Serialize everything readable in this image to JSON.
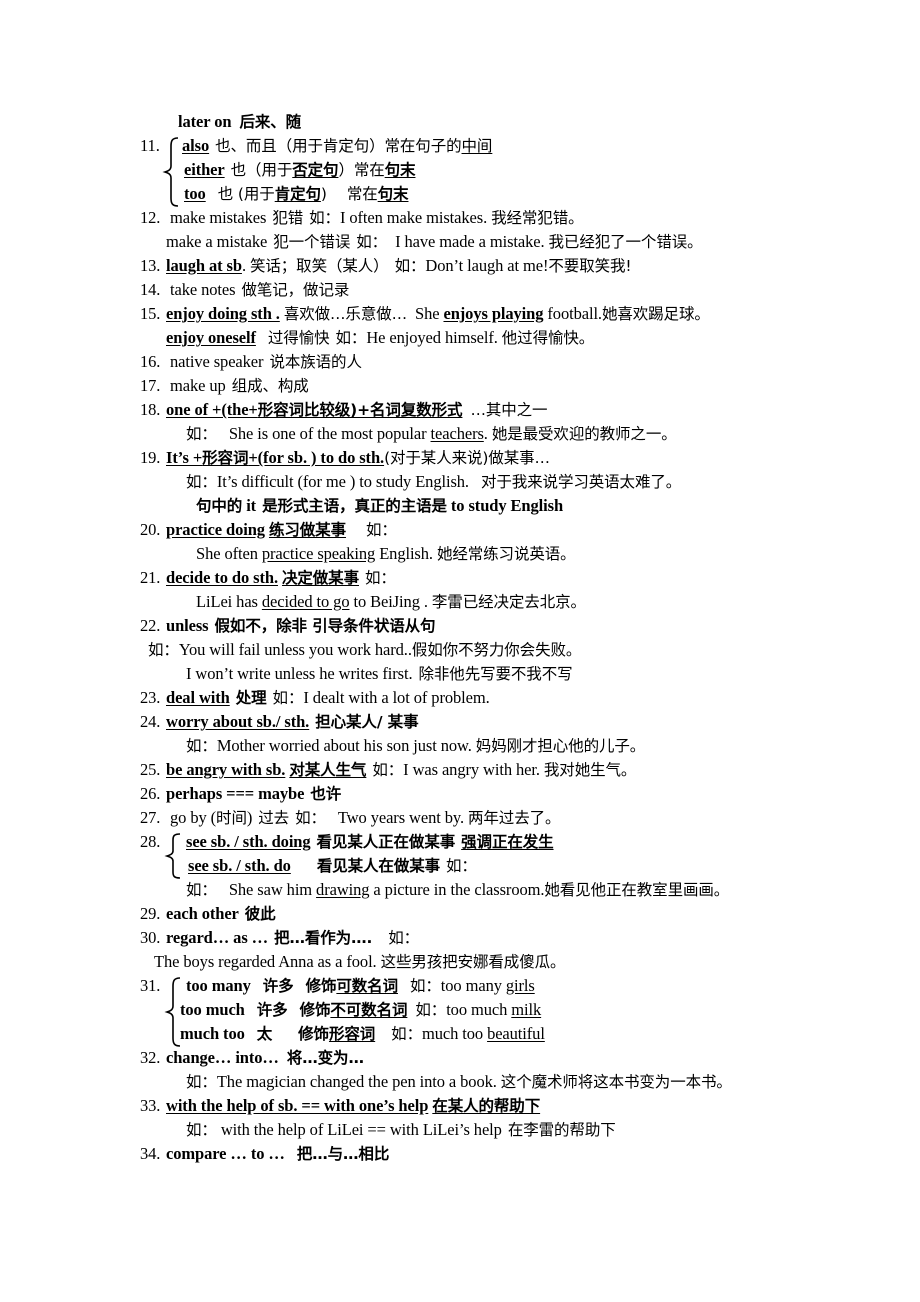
{
  "document": {
    "type": "english-grammar-phrase-notes",
    "lines": [
      {
        "id": "l0",
        "text": "later on  后来、随"
      },
      {
        "id": "l1a",
        "num": "11.",
        "text": "also  也、而且（用于肯定句）常在句子的中间"
      },
      {
        "id": "l1b",
        "text": "either  也（用于否定句）常在句末"
      },
      {
        "id": "l1c",
        "text": "too   也 (用于肯定句)    常在句末"
      },
      {
        "id": "l2",
        "num": "12.",
        "text": "make mistakes  犯错  如：I often make mistakes.  我经常犯错。"
      },
      {
        "id": "l3",
        "text": "make a mistake  犯一个错误  如：  I have made a mistake.  我已经犯了一个错误。"
      },
      {
        "id": "l4",
        "num": "13.",
        "text": "laugh at sb.  笑话；取笑（某人）  如：Don’t laugh at me!不要取笑我!"
      },
      {
        "id": "l5",
        "num": "14.",
        "text": "take notes  做笔记，做记录"
      },
      {
        "id": "l6",
        "num": "15.",
        "text": "enjoy doing sth .  喜欢做…乐意做…  She enjoys playing football.她喜欢踢足球。"
      },
      {
        "id": "l7",
        "text": "enjoy oneself   过得愉快  如：He enjoyed himself.  他过得愉快。"
      },
      {
        "id": "l8",
        "num": "16.",
        "text": "native speaker  说本族语的人"
      },
      {
        "id": "l9",
        "num": "17.",
        "text": "make up  组成、构成"
      },
      {
        "id": "l10",
        "num": "18.",
        "text": "one of +(the+  形容词比较级)+名词复数形式   …其中之一"
      },
      {
        "id": "l11",
        "text": "如：   She is one of the most popular teachers.  她是最受欢迎的教师之一。"
      },
      {
        "id": "l12",
        "num": "19.",
        "text": "It’s +形容词+(for sb. ) to do sth. (对于某人来说)做某事…"
      },
      {
        "id": "l13",
        "text": "如：It’s difficult (for me ) to study English.   对于我来说学习英语太难了。"
      },
      {
        "id": "l14",
        "text": "句中的 it  是形式主语，真正的主语是 to study English"
      },
      {
        "id": "l15",
        "num": "20.",
        "text": "practice doing  练习做某事    如："
      },
      {
        "id": "l16",
        "text": "She often practice speaking English.  她经常练习说英语。"
      },
      {
        "id": "l17",
        "num": "21.",
        "text": "decide to do sth.  决定做某事  如："
      },
      {
        "id": "l18",
        "text": "LiLei has decided to go to BeiJing .  李雷已经决定去北京。"
      },
      {
        "id": "l19",
        "num": "22.",
        "text": "unless  假如不，除非  引导条件状语从句"
      },
      {
        "id": "l20",
        "text": "如：You will fail unless you work hard..假如你不努力你会失败。"
      },
      {
        "id": "l21",
        "text": "I won’t write unless he writes first.  除非他先写要不我不写"
      },
      {
        "id": "l22",
        "num": "23.",
        "text": "deal with  处理  如：I dealt with a lot of problem."
      },
      {
        "id": "l23",
        "num": "24.",
        "text": "worry about sb./ sth.  担心某人/ 某事"
      },
      {
        "id": "l24",
        "text": "如：Mother worried about his son just now.  妈妈刚才担心他的儿子。"
      },
      {
        "id": "l25",
        "num": "25.",
        "text": "be angry with sb.  对某人生气  如：I was angry with her.  我对她生气。"
      },
      {
        "id": "l26",
        "num": "26.",
        "text": "perhaps === maybe  也许"
      },
      {
        "id": "l27",
        "num": "27.",
        "text": "go by (时间)  过去  如：   Two years went by.  两年过去了。"
      },
      {
        "id": "l28a",
        "num": "28.",
        "text": "see sb. / sth. doing  看见某人正在做某事  强调正在发生"
      },
      {
        "id": "l28b",
        "text": "see sb. / sth. do      看见某人在做某事  如："
      },
      {
        "id": "l29",
        "text": "如：   She saw him drawing a picture in the classroom.她看见他正在教室里画画。"
      },
      {
        "id": "l30",
        "num": "29.",
        "text": "each other  彼此"
      },
      {
        "id": "l31",
        "num": "30.",
        "text": "regard… as …  把…看作为….   如："
      },
      {
        "id": "l32",
        "text": "The boys regarded Anna as a fool.  这些男孩把安娜看成傻瓜。"
      },
      {
        "id": "l33a",
        "num": "31.",
        "text": "too many   许多   修饰可数名词   如：too many girls"
      },
      {
        "id": "l33b",
        "text": "too much   许多   修饰不可数名词  如：too much milk"
      },
      {
        "id": "l33c",
        "text": "much too   太    修饰形容词    如：much too beautiful"
      },
      {
        "id": "l34",
        "num": "32.",
        "text": "change…   into…   将…变为…"
      },
      {
        "id": "l35",
        "text": "如：The magician changed the pen into a book.  这个魔术师将这本书变为一本书。"
      },
      {
        "id": "l36",
        "num": "33.",
        "text": "with the help of sb. == with one’s help  在某人的帮助下"
      },
      {
        "id": "l37",
        "text": "如：with the help of LiLei == with LiLei’s help  在李雷的帮助下"
      },
      {
        "id": "l38",
        "num": "34.",
        "text": "compare … to …   把…与…相比"
      }
    ],
    "items": {
      "title_line": {
        "en": "later on",
        "cn": "后来、随"
      },
      "n11": {
        "num": "11.",
        "rows": [
          {
            "head": "also",
            "cn_a": "也、而且（用于肯定句）常在句子的",
            "cn_u": "中间"
          },
          {
            "head": "either",
            "cn_a": "也（用于",
            "cn_u1": "否定句",
            "cn_b": "）常在",
            "cn_u2": "句末"
          },
          {
            "head": "too",
            "cn_a": "也 (用于",
            "cn_u1": "肯定句",
            "cn_b": ")",
            "cn_c": "常在",
            "cn_u2": "句末"
          }
        ]
      },
      "n12": {
        "num": "12.",
        "phrase": "make mistakes",
        "cn": "犯错",
        "ru": "如：",
        "ex_en": "I often make mistakes.",
        "ex_cn": "我经常犯错。",
        "sub_phrase": "make a mistake",
        "sub_cn": "犯一个错误",
        "sub_ru": "如：",
        "sub_ex_en": "I have made a mistake.",
        "sub_ex_cn": "我已经犯了一个错误。"
      },
      "n13": {
        "num": "13.",
        "phrase": "laugh at sb",
        "tail": ".",
        "cn": "笑话；取笑（某人）",
        "ru": "如：",
        "ex_en": "Don’t laugh at me!",
        "ex_cn": "不要取笑我!"
      },
      "n14": {
        "num": "14.",
        "phrase": "take notes",
        "cn": "做笔记，做记录"
      },
      "n15": {
        "num": "15.",
        "phrase": "enjoy doing sth .",
        "cn": "喜欢做…乐意做…",
        "ex_lead": "She",
        "ex_bold": "enjoys playing",
        "ex_rest": "football.",
        "ex_cn": "她喜欢踢足球。",
        "sub_phrase": "enjoy oneself",
        "sub_cn": "过得愉快",
        "sub_ru": "如：",
        "sub_ex_en": "He enjoyed himself.",
        "sub_ex_cn": "他过得愉快。"
      },
      "n16": {
        "num": "16.",
        "phrase": "native speaker",
        "cn": "说本族语的人"
      },
      "n17": {
        "num": "17.",
        "phrase": "make up",
        "cn": "组成、构成"
      },
      "n18": {
        "num": "18.",
        "phrase_a": "one of +(the+",
        "phrase_cn": "形容词比较级)+名词复数形式",
        "cn": "…其中之一",
        "ru": "如：",
        "ex_a": "She is one of the most popular",
        "ex_u": "teachers",
        "ex_b": ".",
        "ex_cn": "她是最受欢迎的教师之一。"
      },
      "n19": {
        "num": "19.",
        "phrase_a": "It’s +",
        "phrase_cn": "形容词",
        "phrase_b": "+(for sb. ) to do sth.",
        "cn": "(对于某人来说)做某事…",
        "ru": "如：",
        "ex_en": "It’s difficult (for me ) to study English.",
        "ex_cn": "对于我来说学习英语太难了。",
        "note_cn_a": "句中的",
        "note_it": "it",
        "note_cn_b": "是形式主语，真正的主语是",
        "note_en": "to study English"
      },
      "n20": {
        "num": "20.",
        "phrase": "practice doing",
        "cn": "练习做某事",
        "ru": "如：",
        "ex_a": "She often",
        "ex_u": "practice speaking",
        "ex_b": "English.",
        "ex_cn": "她经常练习说英语。"
      },
      "n21": {
        "num": "21.",
        "phrase": "decide to do sth.",
        "cn": "决定做某事",
        "ru": "如：",
        "ex_a": "LiLei has",
        "ex_u": "decided to go",
        "ex_b": "to BeiJing .",
        "ex_cn": "李雷已经决定去北京。"
      },
      "n22": {
        "num": "22.",
        "phrase": "unless",
        "cn": "假如不，除非  引导条件状语从句",
        "ru": "如：",
        "ex1_en": "You will fail unless you work hard..",
        "ex1_cn": "假如你不努力你会失败。",
        "ex2_en": "I won’t write unless he writes first.",
        "ex2_cn": "除非他先写要不我不写"
      },
      "n23": {
        "num": "23.",
        "phrase": "deal with",
        "cn": "处理",
        "ru": "如：",
        "ex_en": "I dealt with a lot of problem."
      },
      "n24": {
        "num": "24.",
        "phrase": "worry about sb./ sth.",
        "cn": "担心某人/ 某事",
        "ru": "如：",
        "ex_en": "Mother worried about his son just now.",
        "ex_cn": "妈妈刚才担心他的儿子。"
      },
      "n25": {
        "num": "25.",
        "phrase": "be angry with sb.",
        "cn": "对某人生气",
        "ru": "如：",
        "ex_en": "I was angry with her.",
        "ex_cn": "我对她生气。"
      },
      "n26": {
        "num": "26.",
        "phrase": "perhaps === maybe",
        "cn": "也许"
      },
      "n27": {
        "num": "27.",
        "phrase_a": "go by (",
        "phrase_cn": "时间",
        "phrase_b": ")",
        "cn": "过去",
        "ru": "如：",
        "ex_en": "Two years went by.",
        "ex_cn": "两年过去了。"
      },
      "n28": {
        "num": "28.",
        "rows": [
          {
            "phrase": "see sb. / sth. doing",
            "cn": "看见某人正在做某事",
            "cn_u": "强调正在发生"
          },
          {
            "phrase": "see sb. / sth. do",
            "cn": "看见某人在做某事",
            "ru": "如："
          }
        ],
        "ru": "如：",
        "ex_a": "She saw him",
        "ex_u": "drawing",
        "ex_b": "a picture in the classroom.",
        "ex_cn": "她看见他正在教室里画画。"
      },
      "n29": {
        "num": "29.",
        "phrase": "each other",
        "cn": "彼此"
      },
      "n30": {
        "num": "30.",
        "phrase": "regard… as …",
        "cn": "把…看作为….",
        "ru": "如：",
        "ex_en": "The boys regarded Anna as a fool.",
        "ex_cn": "这些男孩把安娜看成傻瓜。"
      },
      "n31": {
        "num": "31.",
        "rows": [
          {
            "phrase": "too many",
            "cn1": "许多",
            "cn2a": "修饰",
            "cn2u": "可数名词",
            "ru": "如：",
            "ex_a": "too many",
            "ex_u": "girls"
          },
          {
            "phrase": "too much",
            "cn1": "许多",
            "cn2a": "修饰",
            "cn2u": "不可数名词",
            "ru": "如：",
            "ex_a": "too much",
            "ex_u": "milk"
          },
          {
            "phrase": "much too",
            "cn1": "太",
            "cn2a": "修饰",
            "cn2u": "形容词",
            "ru": "如：",
            "ex_a": "much too",
            "ex_u": "beautiful"
          }
        ]
      },
      "n32": {
        "num": "32.",
        "phrase": "change…   into…",
        "cn": "将…变为…",
        "ru": "如：",
        "ex_en": "The magician changed the pen into a book.",
        "ex_cn": "这个魔术师将这本书变为一本书。"
      },
      "n33": {
        "num": "33.",
        "phrase": "with the help of sb. == with one’s help",
        "cn": "在某人的帮助下",
        "ru": "如：",
        "ex_en": "with the help of LiLei == with LiLei’s help",
        "ex_cn": "在李雷的帮助下"
      },
      "n34": {
        "num": "34.",
        "phrase": "compare … to …",
        "cn": "把…与…相比"
      }
    }
  }
}
